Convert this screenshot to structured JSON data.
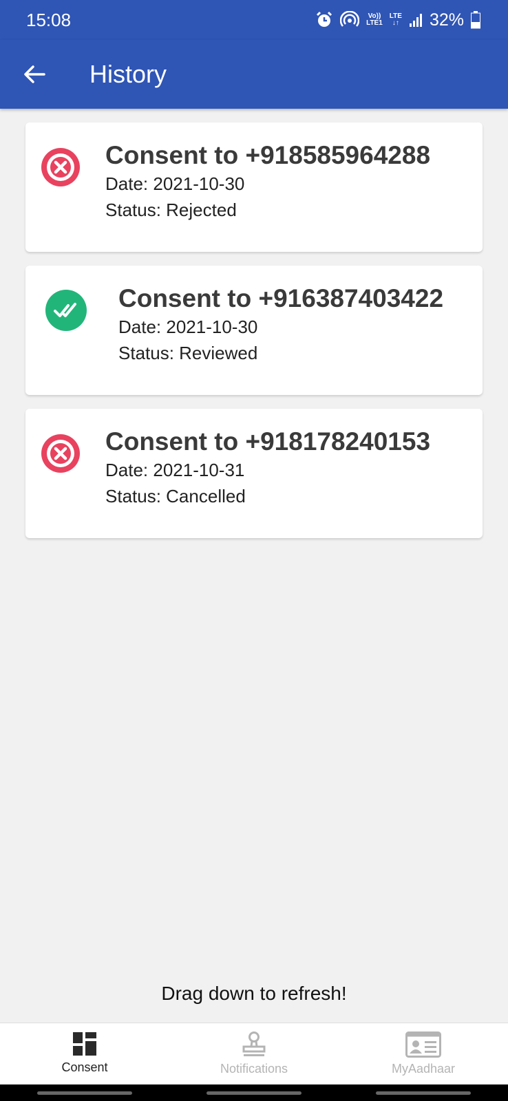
{
  "status_bar": {
    "time": "15:08",
    "net_line1": "Vo))",
    "net_line2": "LTE1",
    "lte_label": "LTE",
    "battery": "32%"
  },
  "app_bar": {
    "title": "History"
  },
  "consents": [
    {
      "title": "Consent to +918585964288",
      "date": "Date: 2021-10-30",
      "status": "Status: Rejected",
      "icon": "x-circle-icon",
      "color": "#e8425f"
    },
    {
      "title": "Consent to +916387403422",
      "date": "Date: 2021-10-30",
      "status": "Status: Reviewed",
      "icon": "double-check-icon",
      "color": "#22b57a"
    },
    {
      "title": "Consent to +918178240153",
      "date": "Date: 2021-10-31",
      "status": "Status: Cancelled",
      "icon": "x-circle-icon",
      "color": "#e8425f"
    }
  ],
  "refresh_hint": "Drag down to refresh!",
  "bottom_nav": {
    "items": [
      {
        "label": "Consent",
        "icon": "dashboard-icon",
        "active": true
      },
      {
        "label": "Notifications",
        "icon": "stamp-icon",
        "active": false
      },
      {
        "label": "MyAadhaar",
        "icon": "id-card-icon",
        "active": false
      }
    ]
  },
  "colors": {
    "primary": "#2f55b5",
    "rejected": "#e8425f",
    "reviewed": "#22b57a"
  }
}
